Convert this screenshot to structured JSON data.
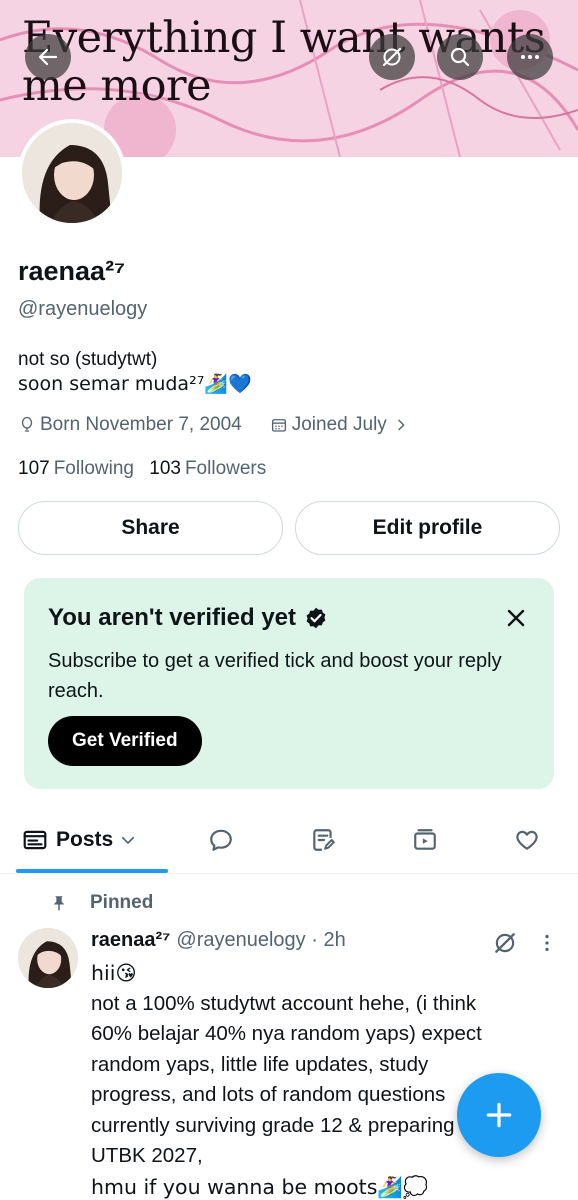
{
  "banner": {
    "text": "Everything I want wants me more"
  },
  "profile": {
    "name": "raenaa²⁷",
    "handle": "@rayenuelogy",
    "bio_line1": "not so (studytwt)",
    "bio_line2": "soon semar muda²⁷🏄‍♀️💙",
    "born": "Born November 7, 2004",
    "joined": "Joined July",
    "following_count": "107",
    "following_label": "Following",
    "followers_count": "103",
    "followers_label": "Followers"
  },
  "actions": {
    "share": "Share",
    "edit_profile": "Edit profile"
  },
  "verify": {
    "title": "You aren't verified yet",
    "description": "Subscribe to get a verified tick and boost your reply reach.",
    "button": "Get Verified"
  },
  "tabs": {
    "posts": "Posts"
  },
  "post": {
    "pinned_label": "Pinned",
    "name": "raenaa²⁷",
    "handle_time": "@rayenuelogy · 2h",
    "lines": [
      "hii😘",
      "not a 100% studytwt account hehe, (i think",
      "60% belajar 40% nya random yaps) expect",
      "random yaps, little life updates, study",
      "progress, and lots of random questions",
      "currently surviving grade 12 & preparing",
      "UTBK 2027,",
      "hmu if you wanna be moots🏄‍♀️💭"
    ]
  },
  "colors": {
    "accent": "#1d9bf0",
    "verify_bg": "#dcf5e8",
    "secondary_text": "#536471"
  }
}
